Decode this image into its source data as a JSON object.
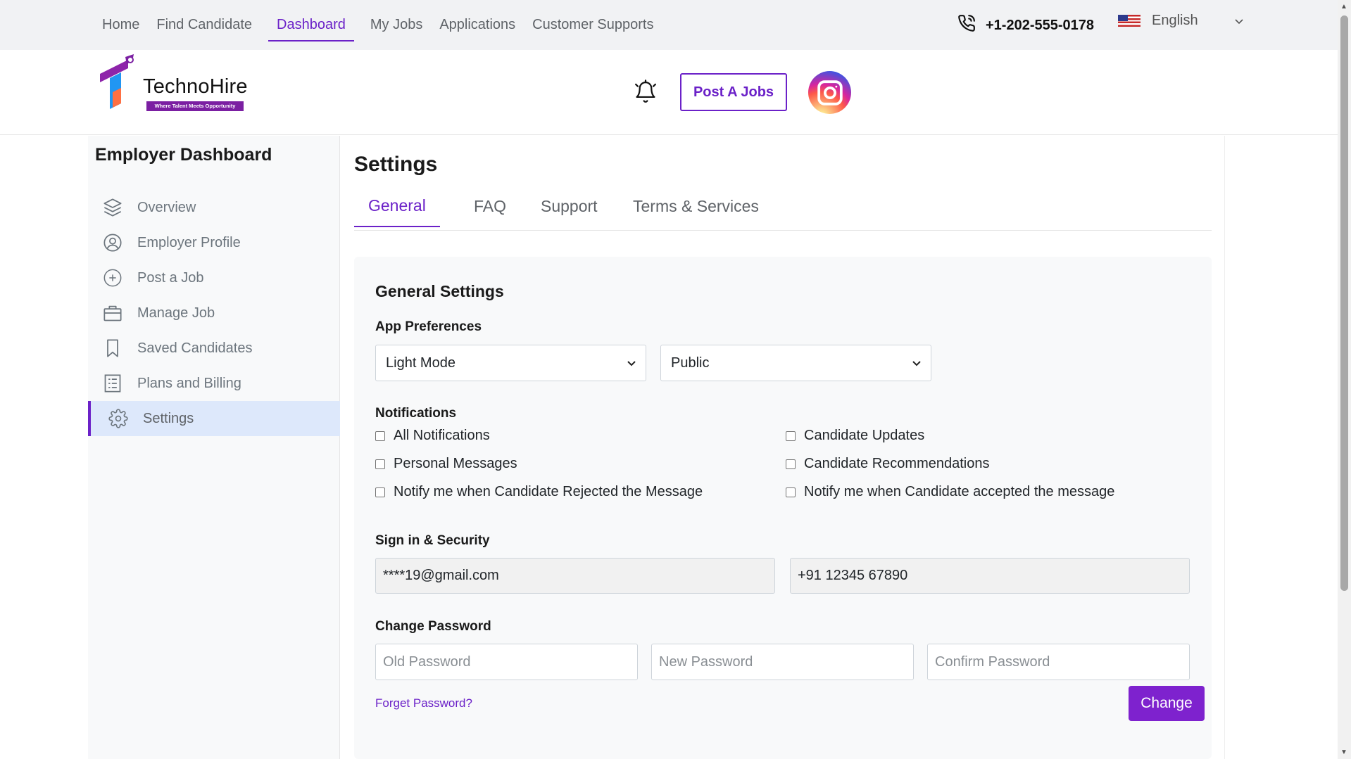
{
  "topbar": {
    "nav": [
      {
        "label": "Home"
      },
      {
        "label": "Find Candidate"
      },
      {
        "label": "Dashboard"
      },
      {
        "label": "My Jobs"
      },
      {
        "label": "Applications"
      },
      {
        "label": "Customer Supports"
      }
    ],
    "active_nav": "Dashboard",
    "phone": "+1-202-555-0178",
    "language": "English"
  },
  "header": {
    "logo_name": "TechnoHire",
    "logo_tagline": "Where Talent Meets Opportunity",
    "post_button": "Post A Jobs"
  },
  "sidebar": {
    "title": "Employer Dashboard",
    "items": [
      {
        "label": "Overview",
        "icon": "layers-icon"
      },
      {
        "label": "Employer Profile",
        "icon": "user-circle-icon"
      },
      {
        "label": "Post a Job",
        "icon": "plus-circle-icon"
      },
      {
        "label": "Manage Job",
        "icon": "briefcase-icon"
      },
      {
        "label": "Saved Candidates",
        "icon": "bookmark-icon"
      },
      {
        "label": "Plans and Billing",
        "icon": "receipt-icon"
      },
      {
        "label": "Settings",
        "icon": "gear-icon"
      }
    ],
    "active_item": "Settings"
  },
  "main": {
    "title": "Settings",
    "tabs": [
      {
        "label": "General"
      },
      {
        "label": "FAQ"
      },
      {
        "label": "Support"
      },
      {
        "label": "Terms & Services"
      }
    ],
    "active_tab": "General"
  },
  "settings": {
    "title": "General Settings",
    "app_preferences": {
      "label": "App Preferences",
      "theme_value": "Light Mode",
      "visibility_value": "Public"
    },
    "notifications": {
      "label": "Notifications",
      "options": [
        {
          "label": "All Notifications",
          "checked": false
        },
        {
          "label": "Candidate Updates",
          "checked": false
        },
        {
          "label": "Personal Messages",
          "checked": false
        },
        {
          "label": "Candidate Recommendations",
          "checked": false
        },
        {
          "label": "Notify me when Candidate Rejected the Message",
          "checked": false
        },
        {
          "label": "Notify me when Candidate accepted the message",
          "checked": false
        }
      ]
    },
    "security": {
      "label": "Sign in & Security",
      "email": "****19@gmail.com",
      "phone": "+91 12345 67890"
    },
    "password": {
      "label": "Change Password",
      "old_placeholder": "Old Password",
      "new_placeholder": "New Password",
      "confirm_placeholder": "Confirm Password",
      "forget_link": "Forget Password?",
      "change_button": "Change"
    }
  },
  "colors": {
    "accent": "#6b21c8",
    "button": "#7e22ce",
    "active_menu_bg": "#dde8fb",
    "topbar_bg": "#f1f2f4"
  }
}
